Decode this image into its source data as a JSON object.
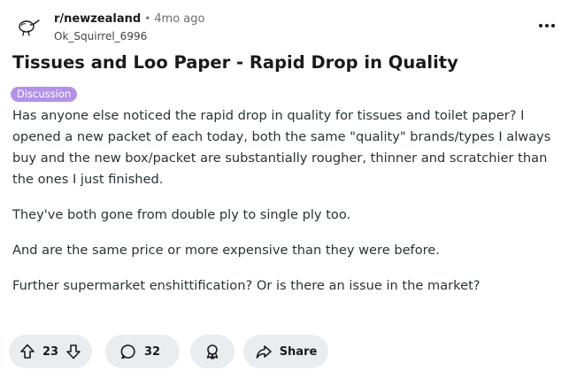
{
  "post": {
    "subreddit": "r/newzealand",
    "separator": "•",
    "time_ago": "4mo ago",
    "author": "Ok_Squirrel_6996",
    "title": "Tissues and Loo Paper - Rapid Drop in Quality",
    "flair": {
      "label": "Discussion",
      "color": "#b392e8"
    },
    "body": [
      "Has anyone else noticed the rapid drop in quality for tissues and toilet paper? I opened a new packet of each today, both the same \"quality\" brands/types I always buy and the new box/packet are substantially rougher, thinner and scratchier than the ones I just finished.",
      "They've both gone from double ply to single ply too.",
      "And are the same price or more expensive than they were before.",
      "Further supermarket enshittification? Or is there an issue in the market?"
    ]
  },
  "actions": {
    "upvote_icon": "arrow-up-icon",
    "downvote_icon": "arrow-down-icon",
    "vote_count": "23",
    "comment_icon": "speech-bubble-icon",
    "comment_count": "32",
    "award_icon": "award-icon",
    "share_icon": "share-arrow-icon",
    "share_label": "Share",
    "pill_color": "#eaedef"
  },
  "icons": {
    "subreddit_avatar": "kiwi-bird-icon",
    "more": "more-options-icon"
  }
}
